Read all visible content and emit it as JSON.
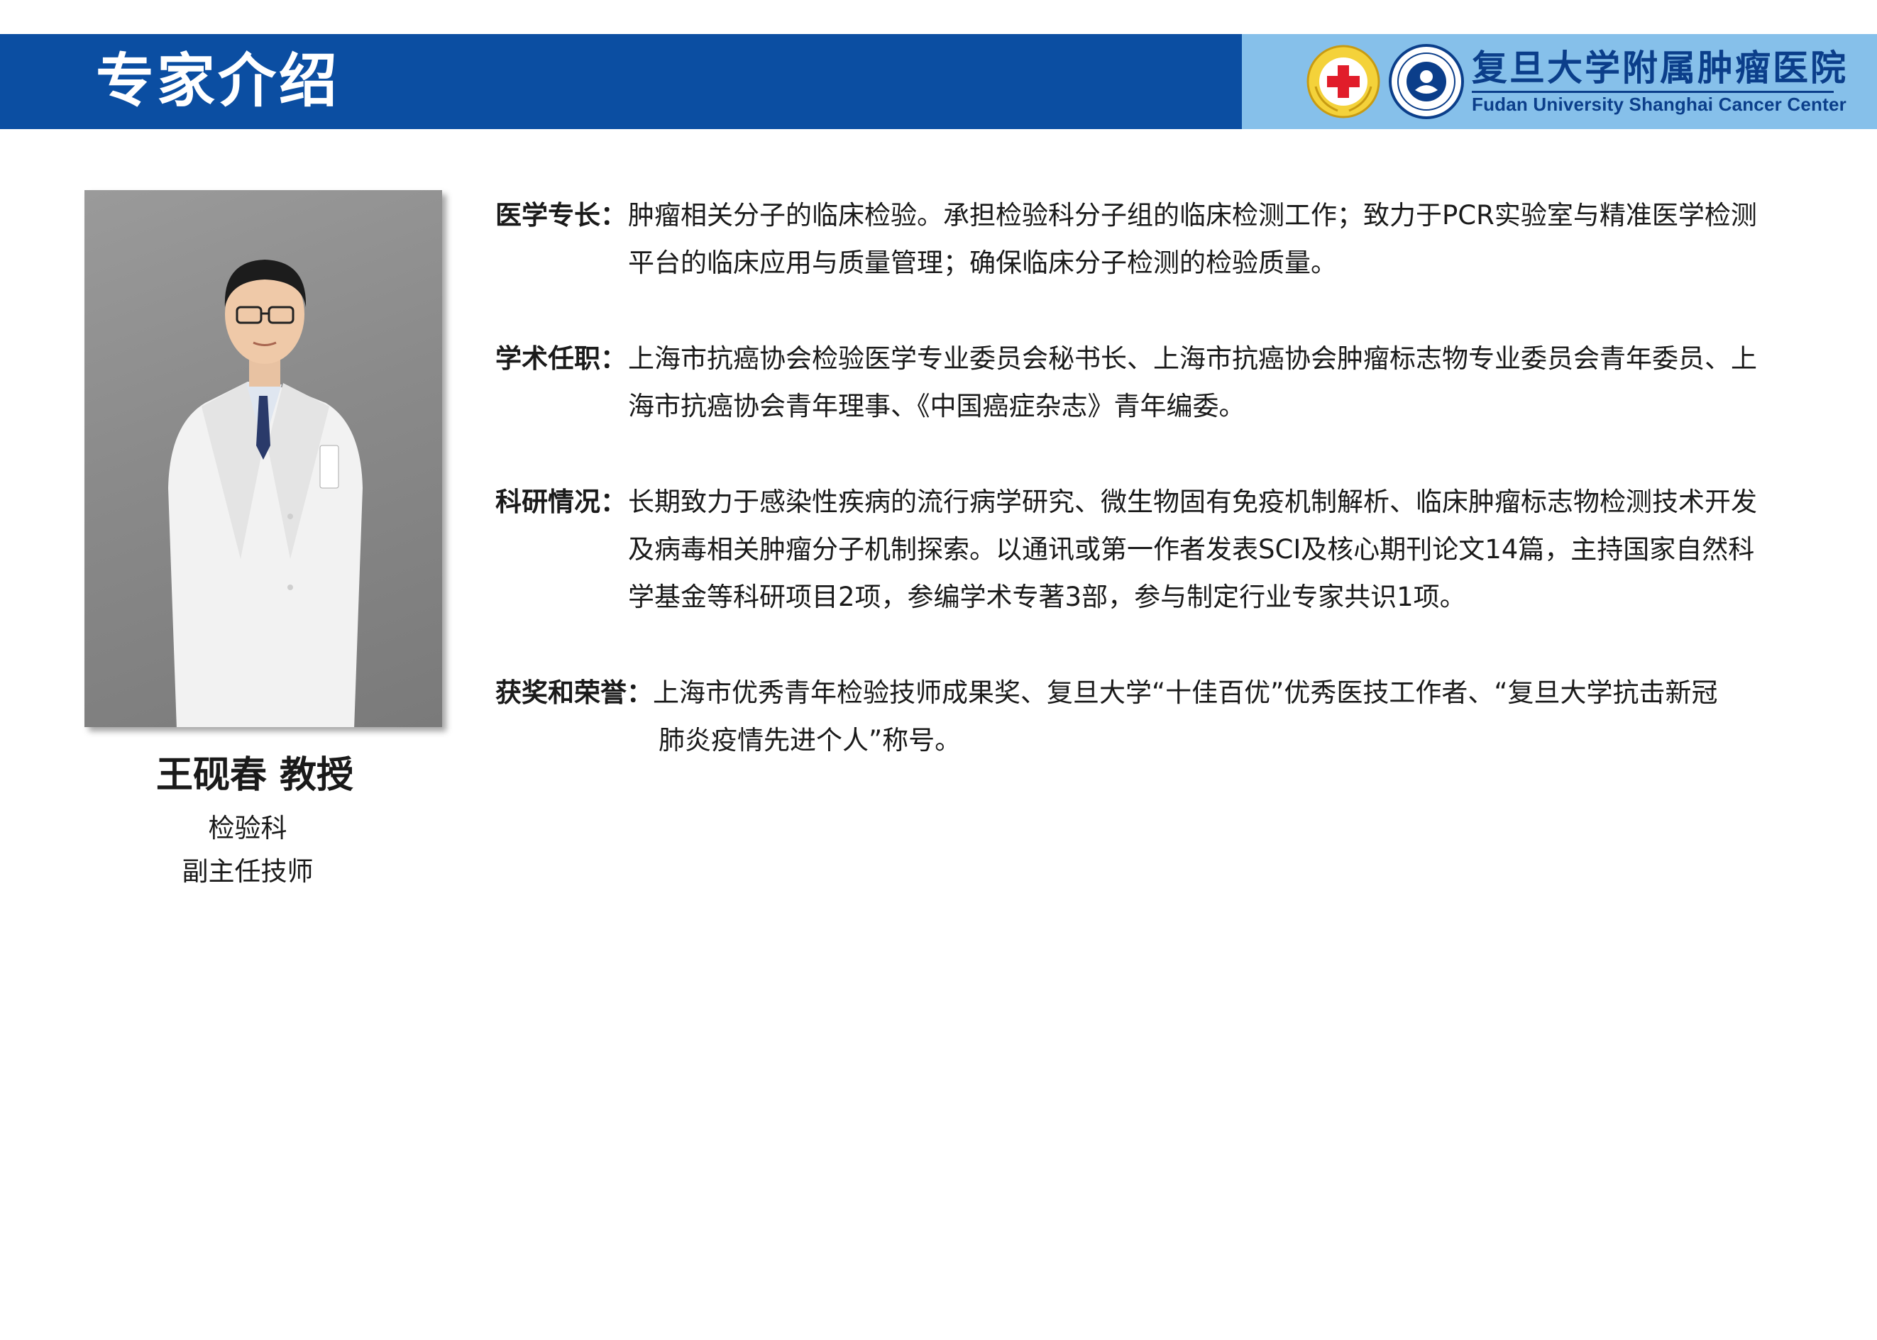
{
  "header": {
    "title": "专家介绍",
    "hospital_name_cn": "复旦大学附属肿瘤医院",
    "hospital_name_en": "Fudan University Shanghai Cancer Center",
    "colors": {
      "bar": "#0b4ea2",
      "logo_panel": "#86c0ea"
    }
  },
  "profile": {
    "name": "王砚春 教授",
    "department": "检验科",
    "title": "副主任技师"
  },
  "sections": [
    {
      "label": "医学专长：",
      "lines": [
        "肿瘤相关分子的临床检验。承担检验科分子组的临床检测工作；致力于PCR实验室与精准医学检测",
        "平台的临床应用与质量管理；确保临床分子检测的检验质量。"
      ]
    },
    {
      "label": "学术任职：",
      "lines": [
        "上海市抗癌协会检验医学专业委员会秘书长、上海市抗癌协会肿瘤标志物专业委员会青年委员、上",
        "海市抗癌协会青年理事、《中国癌症杂志》青年编委。"
      ]
    },
    {
      "label": "科研情况：",
      "lines": [
        "长期致力于感染性疾病的流行病学研究、微生物固有免疫机制解析、临床肿瘤标志物检测技术开发",
        "及病毒相关肿瘤分子机制探索。以通讯或第一作者发表SCI及核心期刊论文14篇，主持国家自然科",
        "学基金等科研项目2项，参编学术专著3部，参与制定行业专家共识1项。"
      ]
    },
    {
      "label": "获奖和荣誉：",
      "lines": [
        "上海市优秀青年检验技师成果奖、复旦大学“十佳百优”优秀医技工作者、“复旦大学抗击新冠",
        "肺炎疫情先进个人”称号。"
      ]
    }
  ]
}
